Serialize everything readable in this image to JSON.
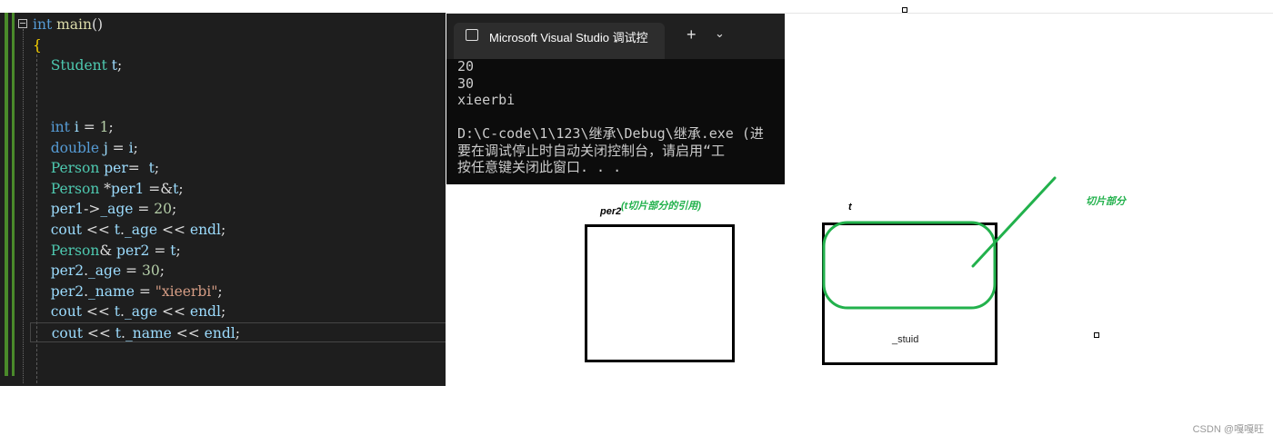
{
  "editor": {
    "lines": [
      [
        {
          "c": "kw",
          "t": "int "
        },
        {
          "c": "fn",
          "t": "main"
        },
        {
          "c": "pl",
          "t": "()"
        }
      ],
      [
        {
          "c": "br",
          "t": "{"
        }
      ],
      [
        {
          "c": "pl",
          "t": "    "
        },
        {
          "c": "ty",
          "t": "Student "
        },
        {
          "c": "id",
          "t": "t"
        },
        {
          "c": "pl",
          "t": ";"
        }
      ],
      [],
      [],
      [
        {
          "c": "pl",
          "t": "    "
        },
        {
          "c": "kw",
          "t": "int "
        },
        {
          "c": "id",
          "t": "i"
        },
        {
          "c": "pl",
          "t": " = "
        },
        {
          "c": "num",
          "t": "1"
        },
        {
          "c": "pl",
          "t": ";"
        }
      ],
      [
        {
          "c": "pl",
          "t": "    "
        },
        {
          "c": "kw",
          "t": "double "
        },
        {
          "c": "id",
          "t": "j"
        },
        {
          "c": "pl",
          "t": " = "
        },
        {
          "c": "id",
          "t": "i"
        },
        {
          "c": "pl",
          "t": ";"
        }
      ],
      [
        {
          "c": "pl",
          "t": "    "
        },
        {
          "c": "ty",
          "t": "Person "
        },
        {
          "c": "id",
          "t": "per"
        },
        {
          "c": "pl",
          "t": "=  "
        },
        {
          "c": "id",
          "t": "t"
        },
        {
          "c": "pl",
          "t": ";"
        }
      ],
      [
        {
          "c": "pl",
          "t": "    "
        },
        {
          "c": "ty",
          "t": "Person "
        },
        {
          "c": "pl",
          "t": "*"
        },
        {
          "c": "id",
          "t": "per1"
        },
        {
          "c": "pl",
          "t": " =&"
        },
        {
          "c": "id",
          "t": "t"
        },
        {
          "c": "pl",
          "t": ";"
        }
      ],
      [
        {
          "c": "pl",
          "t": "    "
        },
        {
          "c": "id",
          "t": "per1"
        },
        {
          "c": "pl",
          "t": "->"
        },
        {
          "c": "id",
          "t": "_age"
        },
        {
          "c": "pl",
          "t": " = "
        },
        {
          "c": "num",
          "t": "20"
        },
        {
          "c": "pl",
          "t": ";"
        }
      ],
      [
        {
          "c": "pl",
          "t": "    "
        },
        {
          "c": "id",
          "t": "cout"
        },
        {
          "c": "pl",
          "t": " << "
        },
        {
          "c": "id",
          "t": "t"
        },
        {
          "c": "pl",
          "t": "."
        },
        {
          "c": "id",
          "t": "_age"
        },
        {
          "c": "pl",
          "t": " << "
        },
        {
          "c": "id",
          "t": "endl"
        },
        {
          "c": "pl",
          "t": ";"
        }
      ],
      [
        {
          "c": "pl",
          "t": "    "
        },
        {
          "c": "ty",
          "t": "Person"
        },
        {
          "c": "pl",
          "t": "& "
        },
        {
          "c": "id",
          "t": "per2"
        },
        {
          "c": "pl",
          "t": " = "
        },
        {
          "c": "id",
          "t": "t"
        },
        {
          "c": "pl",
          "t": ";"
        }
      ],
      [
        {
          "c": "pl",
          "t": "    "
        },
        {
          "c": "id",
          "t": "per2"
        },
        {
          "c": "pl",
          "t": "."
        },
        {
          "c": "id",
          "t": "_age"
        },
        {
          "c": "pl",
          "t": " = "
        },
        {
          "c": "num",
          "t": "30"
        },
        {
          "c": "pl",
          "t": ";"
        }
      ],
      [
        {
          "c": "pl",
          "t": "    "
        },
        {
          "c": "id",
          "t": "per2"
        },
        {
          "c": "pl",
          "t": "."
        },
        {
          "c": "id",
          "t": "_name"
        },
        {
          "c": "pl",
          "t": " = "
        },
        {
          "c": "str",
          "t": "\"xieerbi\""
        },
        {
          "c": "pl",
          "t": ";"
        }
      ],
      [
        {
          "c": "pl",
          "t": "    "
        },
        {
          "c": "id",
          "t": "cout"
        },
        {
          "c": "pl",
          "t": " << "
        },
        {
          "c": "id",
          "t": "t"
        },
        {
          "c": "pl",
          "t": "."
        },
        {
          "c": "id",
          "t": "_age"
        },
        {
          "c": "pl",
          "t": " << "
        },
        {
          "c": "id",
          "t": "endl"
        },
        {
          "c": "pl",
          "t": ";"
        }
      ],
      [
        {
          "c": "pl",
          "t": "    "
        },
        {
          "c": "id",
          "t": "cout"
        },
        {
          "c": "pl",
          "t": " << "
        },
        {
          "c": "id",
          "t": "t"
        },
        {
          "c": "pl",
          "t": "."
        },
        {
          "c": "id",
          "t": "_name"
        },
        {
          "c": "pl",
          "t": " << "
        },
        {
          "c": "id",
          "t": "endl"
        },
        {
          "c": "pl",
          "t": ";"
        }
      ]
    ],
    "current_line": 15
  },
  "console": {
    "tab_title": "Microsoft Visual Studio 调试控",
    "new_tab": "+",
    "dropdown": "⌄",
    "lines": [
      "20",
      "30",
      "xieerbi",
      "",
      "D:\\C-code\\1\\123\\继承\\Debug\\继承.exe (进",
      "要在调试停止时自动关闭控制台，请启用“工",
      "按任意键关闭此窗口. . ."
    ]
  },
  "drawing": {
    "per2_label": "per2",
    "per2_note": "(t切片部分的引用)",
    "t_label": "t",
    "slice_note": "切片部分",
    "field_label": "_stuid",
    "accent": "#22b14c"
  },
  "watermark": "CSDN @嘎嘎旺"
}
